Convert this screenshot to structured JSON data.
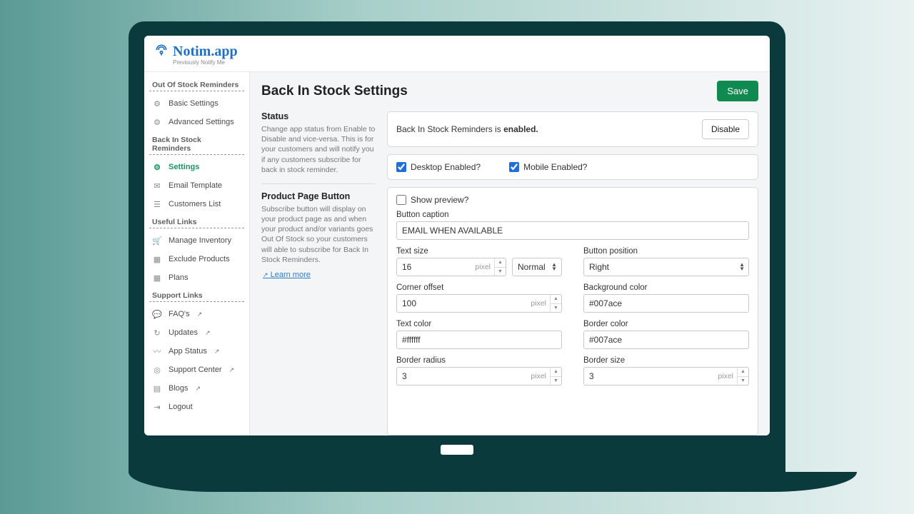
{
  "logo": {
    "name": "Notim.app",
    "sub": "Previously Notify Me"
  },
  "sidebar": {
    "sections": {
      "oos": "Out Of Stock Reminders",
      "bis": "Back In Stock Reminders",
      "useful": "Useful Links",
      "support": "Support Links"
    },
    "items": {
      "basic": "Basic Settings",
      "advanced": "Advanced Settings",
      "settings": "Settings",
      "emailTemplate": "Email Template",
      "customersList": "Customers List",
      "manageInventory": "Manage Inventory",
      "excludeProducts": "Exclude Products",
      "plans": "Plans",
      "faqs": "FAQ's",
      "updates": "Updates",
      "appStatus": "App Status",
      "supportCenter": "Support Center",
      "blogs": "Blogs",
      "logout": "Logout"
    }
  },
  "page": {
    "title": "Back In Stock Settings",
    "save": "Save"
  },
  "status": {
    "heading": "Status",
    "desc": "Change app status from Enable to Disable and vice-versa. This is for your customers and will notify you if any customers subscribe for back in stock reminder.",
    "textPrefix": "Back In Stock Reminders is ",
    "textBold": "enabled.",
    "disable": "Disable",
    "desktop": "Desktop Enabled?",
    "mobile": "Mobile Enabled?"
  },
  "button": {
    "heading": "Product Page Button",
    "desc": "Subscribe button will display on your product page as and when your product and/or variants goes Out Of Stock so your customers will able to subscribe for Back In Stock Reminders.",
    "learn": "Learn more",
    "showPreview": "Show preview?",
    "captionLabel": "Button caption",
    "captionValue": "EMAIL WHEN AVAILABLE",
    "textSizeLabel": "Text size",
    "textSizeValue": "16",
    "textSizeWeight": "Normal",
    "positionLabel": "Button position",
    "positionValue": "Right",
    "cornerLabel": "Corner offset",
    "cornerValue": "100",
    "bgLabel": "Background color",
    "bgValue": "#007ace",
    "textColorLabel": "Text color",
    "textColorValue": "#ffffff",
    "borderColorLabel": "Border color",
    "borderColorValue": "#007ace",
    "borderRadiusLabel": "Border radius",
    "borderRadiusValue": "3",
    "borderSizeLabel": "Border size",
    "borderSizeValue": "3",
    "pixel": "pixel"
  }
}
